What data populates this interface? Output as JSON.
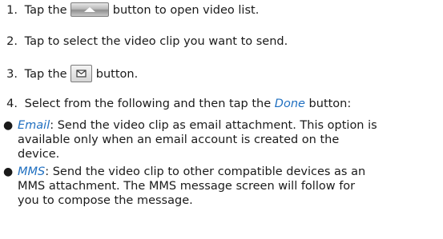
{
  "steps": [
    {
      "number": "1.",
      "text_before": "Tap the",
      "icon": "eject-arrow-icon",
      "text_after": "button to open video list."
    },
    {
      "number": "2.",
      "text": "Tap to select the video clip you want to send."
    },
    {
      "number": "3.",
      "text_before": "Tap the",
      "icon": "envelope-send-icon",
      "text_after": "button."
    },
    {
      "number": "4.",
      "text_before": "Select from the following and then tap the",
      "emphasis": "Done",
      "text_after": "button:"
    }
  ],
  "options": [
    {
      "name": "Email",
      "lines": [
        ": Send the video clip as email attachment. This option is",
        "available only when an email account is created on the",
        "device."
      ]
    },
    {
      "name": "MMS",
      "lines": [
        ": Send the video clip to other compatible devices as an",
        "MMS attachment. The MMS message screen will follow for",
        "you to compose the message."
      ]
    }
  ],
  "colors": {
    "emphasis": "#1f6fc0",
    "text": "#1a1a1a"
  }
}
